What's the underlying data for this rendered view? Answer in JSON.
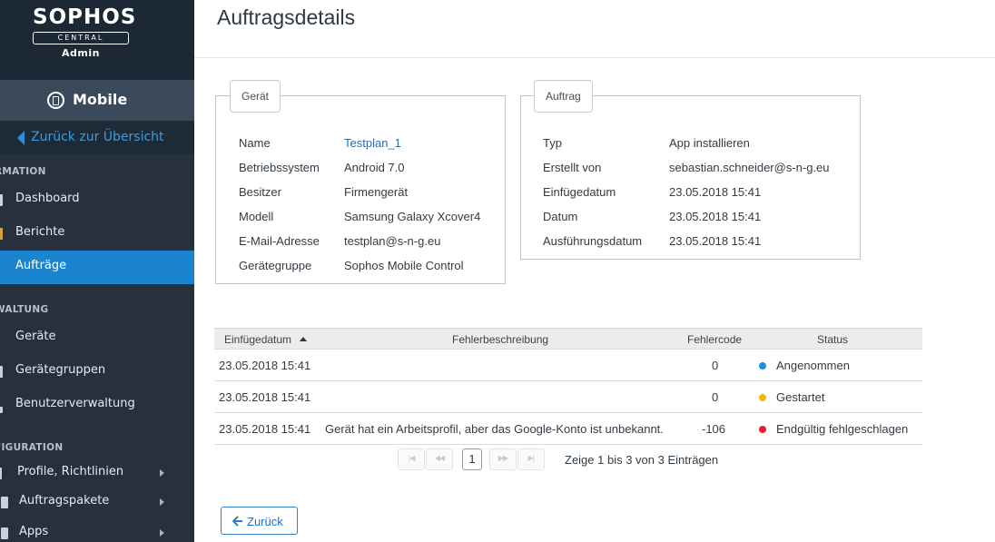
{
  "sidebar": {
    "logo": {
      "brand": "SOPHOS",
      "sub": "CENTRAL",
      "role": "Admin"
    },
    "module": "Mobile",
    "back_link": "Zurück zur Übersicht",
    "sections": [
      {
        "label": "RMATION",
        "items": [
          {
            "label": "Dashboard"
          },
          {
            "label": "Berichte"
          },
          {
            "label": "Aufträge",
            "active": true
          }
        ]
      },
      {
        "label": "WALTUNG",
        "items": [
          {
            "label": "Geräte"
          },
          {
            "label": "Gerätegruppen"
          },
          {
            "label": "Benutzerverwaltung"
          }
        ]
      },
      {
        "label": "FIGURATION",
        "items": [
          {
            "label": "Profile, Richtlinien"
          },
          {
            "label": "Auftragspakete"
          },
          {
            "label": "Apps"
          }
        ]
      }
    ]
  },
  "page": {
    "title": "Auftragsdetails"
  },
  "device": {
    "legend": "Gerät",
    "rows": [
      {
        "label": "Name",
        "value": "Testplan_1"
      },
      {
        "label": "Betriebssystem",
        "value": "Android 7.0"
      },
      {
        "label": "Besitzer",
        "value": "Firmengerät"
      },
      {
        "label": "Modell",
        "value": "Samsung Galaxy Xcover4"
      },
      {
        "label": "E-Mail-Adresse",
        "value": "testplan@s-n-g.eu"
      },
      {
        "label": "Gerätegruppe",
        "value": "Sophos Mobile Control"
      }
    ]
  },
  "task": {
    "legend": "Auftrag",
    "rows": [
      {
        "label": "Typ",
        "value": "App installieren"
      },
      {
        "label": "Erstellt von",
        "value": "sebastian.schneider@s-n-g.eu"
      },
      {
        "label": "Einfügedatum",
        "value": "23.05.2018 15:41"
      },
      {
        "label": "Datum",
        "value": "23.05.2018 15:41"
      },
      {
        "label": "Ausführungsdatum",
        "value": "23.05.2018 15:41"
      }
    ]
  },
  "table": {
    "headers": {
      "date": "Einfügedatum",
      "error": "Fehlerbeschreibung",
      "code": "Fehlercode",
      "status": "Status"
    },
    "rows": [
      {
        "date": "23.05.2018 15:41",
        "error": "",
        "code": "0",
        "status": "Angenommen",
        "status_color": "#1e8fd6"
      },
      {
        "date": "23.05.2018 15:41",
        "error": "",
        "code": "0",
        "status": "Gestartet",
        "status_color": "#f2b705"
      },
      {
        "date": "23.05.2018 15:41",
        "error": "Gerät hat ein Arbeitsprofil, aber das Google-Konto ist unbekannt.",
        "code": "-106",
        "status": "Endgültig fehlgeschlagen",
        "status_color": "#e0232a"
      }
    ]
  },
  "pagination": {
    "current_page": "1",
    "info": "Zeige 1 bis 3 von 3 Einträgen"
  },
  "actions": {
    "back_label": "Zurück"
  },
  "colors": {
    "accent": "#1a84d1",
    "sidebar": "#26313d",
    "link": "#1b6fbf"
  }
}
